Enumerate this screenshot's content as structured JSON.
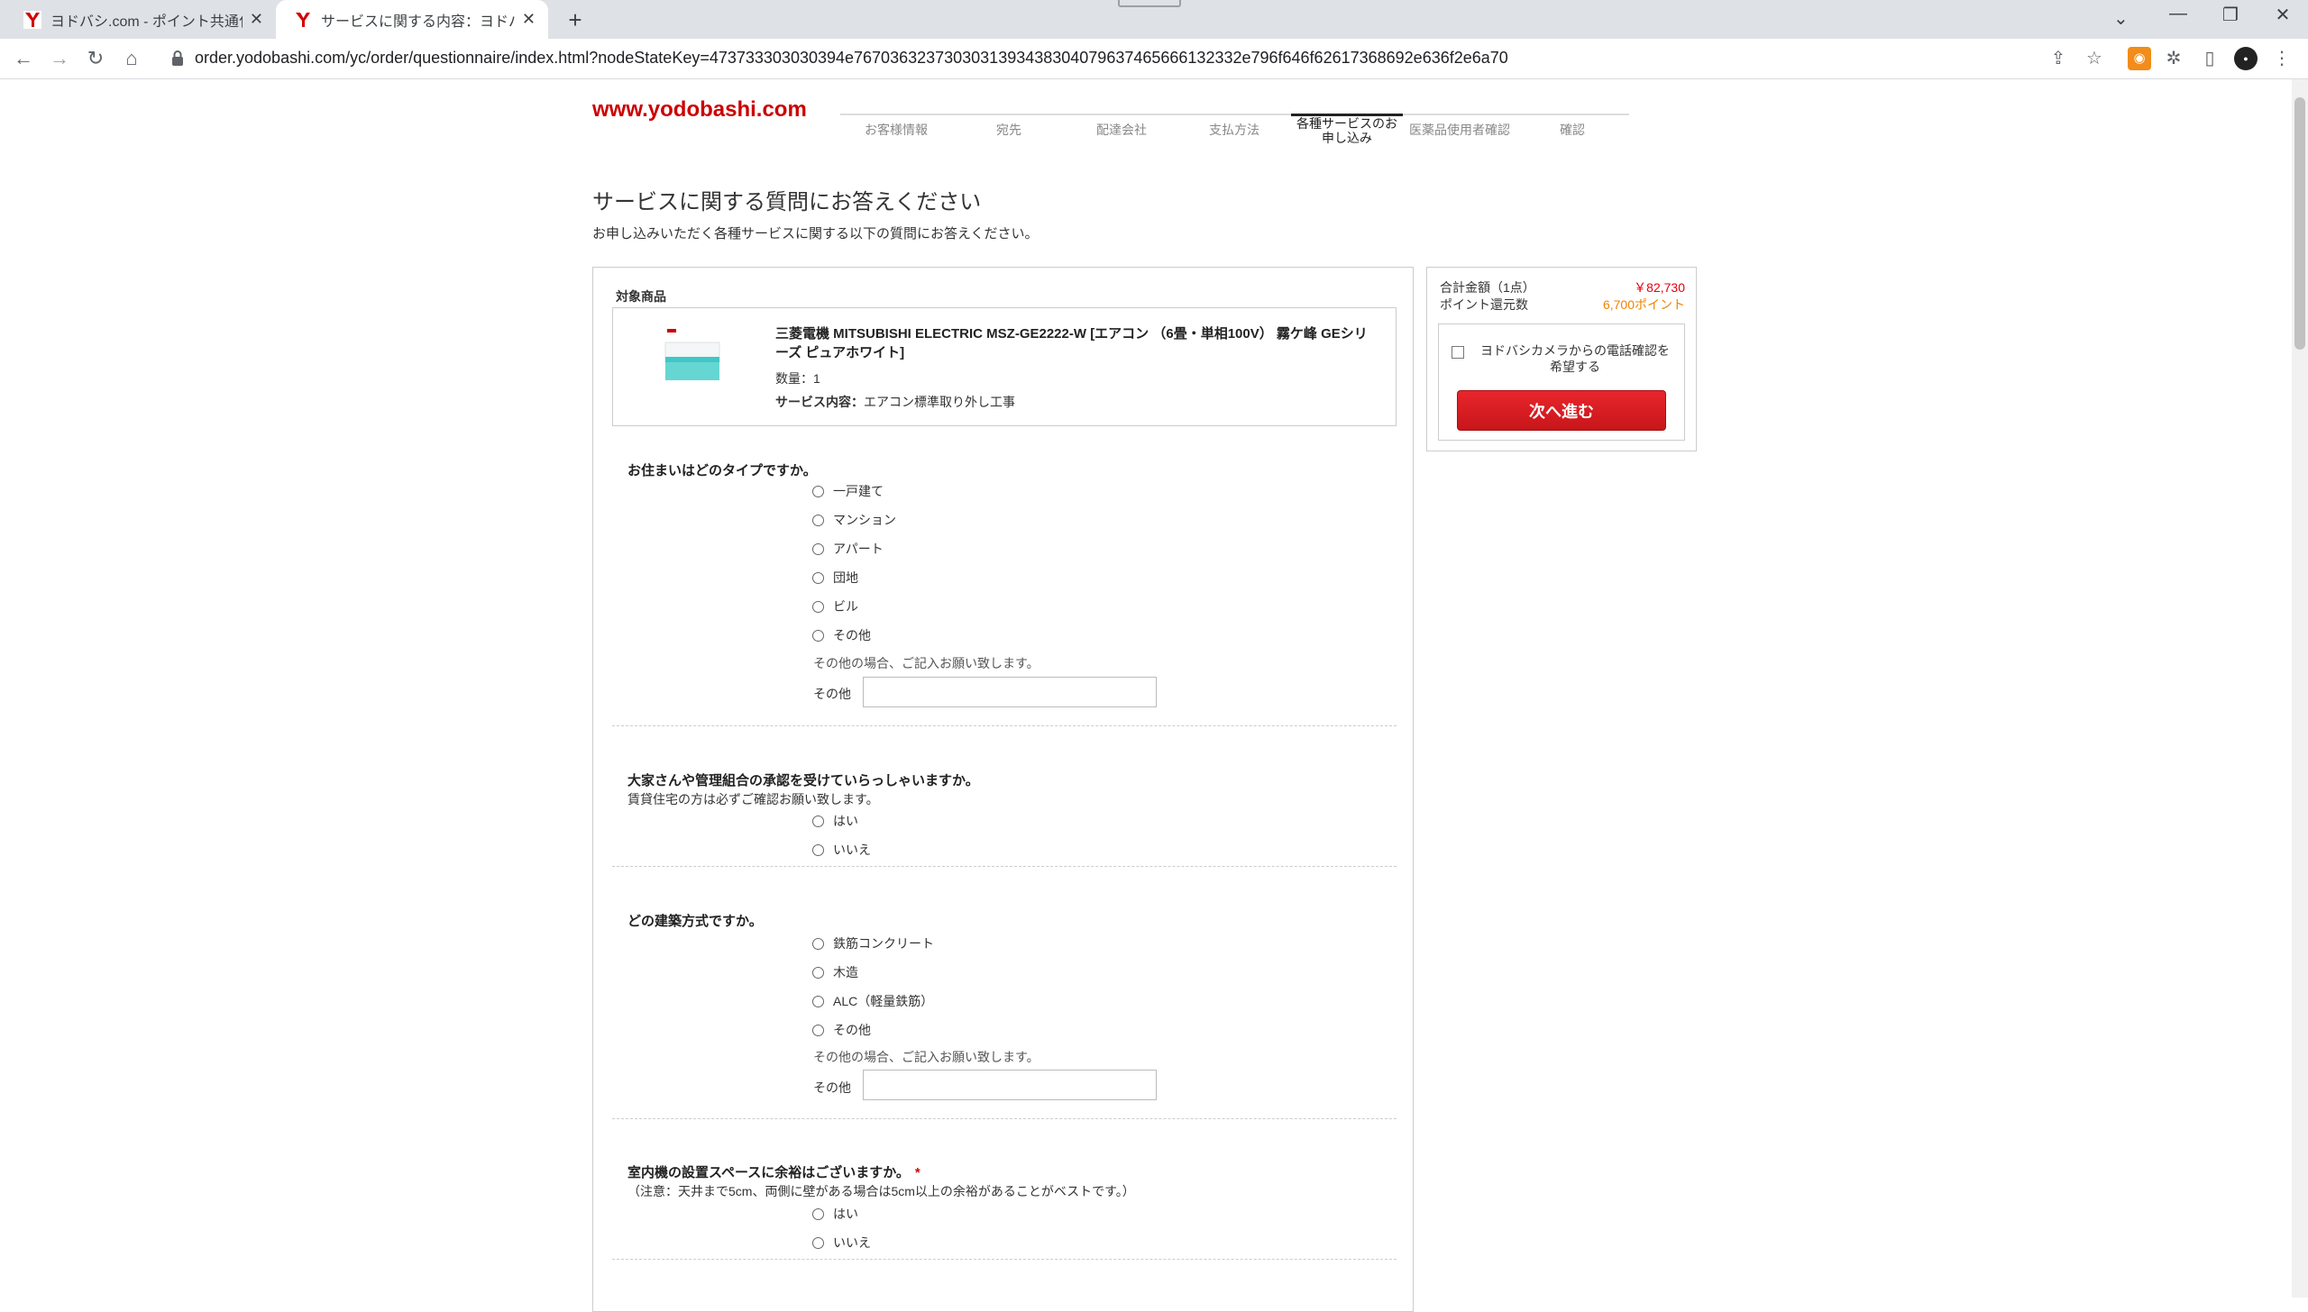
{
  "browser": {
    "tabs": [
      {
        "title": "ヨドバシ.com - ポイント共通化手続き",
        "active": false
      },
      {
        "title": "サービスに関する内容：ヨドバシ.ドットコム",
        "active": true
      }
    ],
    "url": "order.yodobashi.com/yc/order/questionnaire/index.html?nodeStateKey=47373330303039 4e76703632373030313934383040796374656661323 32e796f646f62617368692e636f2e6a70",
    "url_display": "order.yodobashi.com/yc/order/questionnaire/index.html?nodeStateKey=473733303030394e7670363237303031393438304079637465666132332e796f646f62617368692e636f2e6a70"
  },
  "site": {
    "logo": "www.yodobashi.com",
    "steps": [
      {
        "label": "お客様情報",
        "active": false
      },
      {
        "label": "宛先",
        "active": false
      },
      {
        "label": "配達会社",
        "active": false
      },
      {
        "label": "支払方法",
        "active": false
      },
      {
        "label": "各種サービスのお申し込み",
        "active": true
      },
      {
        "label": "医薬品使用者確認",
        "active": false
      },
      {
        "label": "確認",
        "active": false
      }
    ]
  },
  "page": {
    "title": "サービスに関する質問にお答えください",
    "subtitle": "お申し込みいただく各種サービスに関する以下の質問にお答えください。"
  },
  "product": {
    "section_label": "対象商品",
    "name": "三菱電機 MITSUBISHI ELECTRIC MSZ-GE2222-W [エアコン （6畳・単相100V） 霧ケ峰 GEシリーズ ピュアホワイト]",
    "quantity": "数量：1",
    "service_label": "サービス内容：",
    "service_value": "エアコン標準取り外し工事"
  },
  "questions": {
    "q1": {
      "title": "お住まいはどのタイプですか。",
      "options": [
        "一戸建て",
        "マンション",
        "アパート",
        "団地",
        "ビル",
        "その他"
      ],
      "hint": "その他の場合、ご記入お願い致します。",
      "other_label": "その他"
    },
    "q2": {
      "title": "大家さんや管理組合の承認を受けていらっしゃいますか。",
      "note": "賃貸住宅の方は必ずご確認お願い致します。",
      "options": [
        "はい",
        "いいえ"
      ]
    },
    "q3": {
      "title": "どの建築方式ですか。",
      "options": [
        "鉄筋コンクリート",
        "木造",
        "ALC（軽量鉄筋）",
        "その他"
      ],
      "hint": "その他の場合、ご記入お願い致します。",
      "other_label": "その他"
    },
    "q4": {
      "title": "室内機の設置スペースに余裕はございますか。",
      "required_mark": "*",
      "note": "（注意：天井まで5cm、両側に壁がある場合は5cm以上の余裕があることがベストです。）",
      "options": [
        "はい",
        "いいえ"
      ]
    }
  },
  "summary": {
    "total_label": "合計金額（1点）",
    "total_value": "￥82,730",
    "points_label": "ポイント還元数",
    "points_value": "6,700ポイント",
    "phone_confirm": "ヨドバシカメラからの電話確認を希望する",
    "next_button": "次へ進む"
  },
  "colors": {
    "price_red": "#e60012",
    "points_orange": "#f08300",
    "button_red": "#d8171d"
  }
}
